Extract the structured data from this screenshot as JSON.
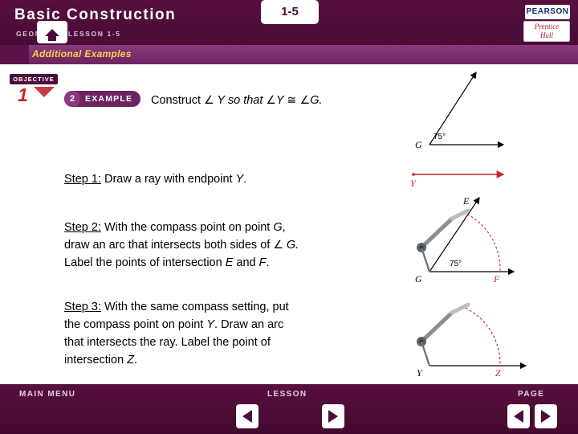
{
  "header": {
    "title": "Basic Construction",
    "subtitle": "GEOMETRY LESSON 1-5",
    "brand_top": "PEARSON",
    "brand_line1": "Prentice",
    "brand_line2": "Hall"
  },
  "banner": {
    "text": "Additional Examples"
  },
  "objective": {
    "label": "OBJECTIVE",
    "number": "1"
  },
  "example": {
    "number": "2",
    "word": "EXAMPLE"
  },
  "content": {
    "prompt_pre": "Construct ",
    "prompt_angle1": "∠",
    "prompt_y1": " Y so that ",
    "prompt_angle2": "∠",
    "prompt_y2": "Y ",
    "prompt_cong": "≅",
    "prompt_angle3": " ∠",
    "prompt_g": "G.",
    "step1_label": "Step 1:",
    "step1_text_a": " Draw a ray with endpoint ",
    "step1_text_b": "Y",
    "step1_text_c": ".",
    "step2_label": "Step 2:",
    "step2_line1": " With the compass point on point ",
    "step2_line1_g": "G",
    "step2_line1_end": ",",
    "step2_line2": "draw an arc that intersects both sides of ",
    "step2_line2_angle": "∠",
    "step2_line2_g": " G.",
    "step2_line3": "Label the points of intersection ",
    "step2_line3_e": "E",
    "step2_line3_and": " and ",
    "step2_line3_f": "F",
    "step2_line3_end": ".",
    "step3_label": "Step 3:",
    "step3_line1": " With the same compass setting, put",
    "step3_line2": "the compass point on point ",
    "step3_line2_y": "Y",
    "step3_line2_end": ". Draw an arc",
    "step3_line3": "that intersects the ray. Label the point of",
    "step3_line4": "intersection ",
    "step3_line4_z": "Z",
    "step3_line4_end": "."
  },
  "figures": {
    "angle_g": {
      "vertex_label": "G",
      "measure": "75°"
    },
    "ray_y": {
      "label": "Y"
    },
    "compass_g": {
      "vertex_label": "G",
      "measure": "75°",
      "point_e": "E",
      "point_f": "F"
    },
    "compass_y": {
      "vertex_label": "Y",
      "point_z": "Z"
    }
  },
  "footer": {
    "main_menu": "MAIN MENU",
    "lesson": "LESSON",
    "page": "PAGE",
    "lesson_number": "1-5"
  },
  "colors": {
    "header_purple": "#4c0d3c",
    "banner_purple": "#7b2e6e",
    "banner_text_yellow": "#ffd24d",
    "accent_red": "#c0272d"
  }
}
